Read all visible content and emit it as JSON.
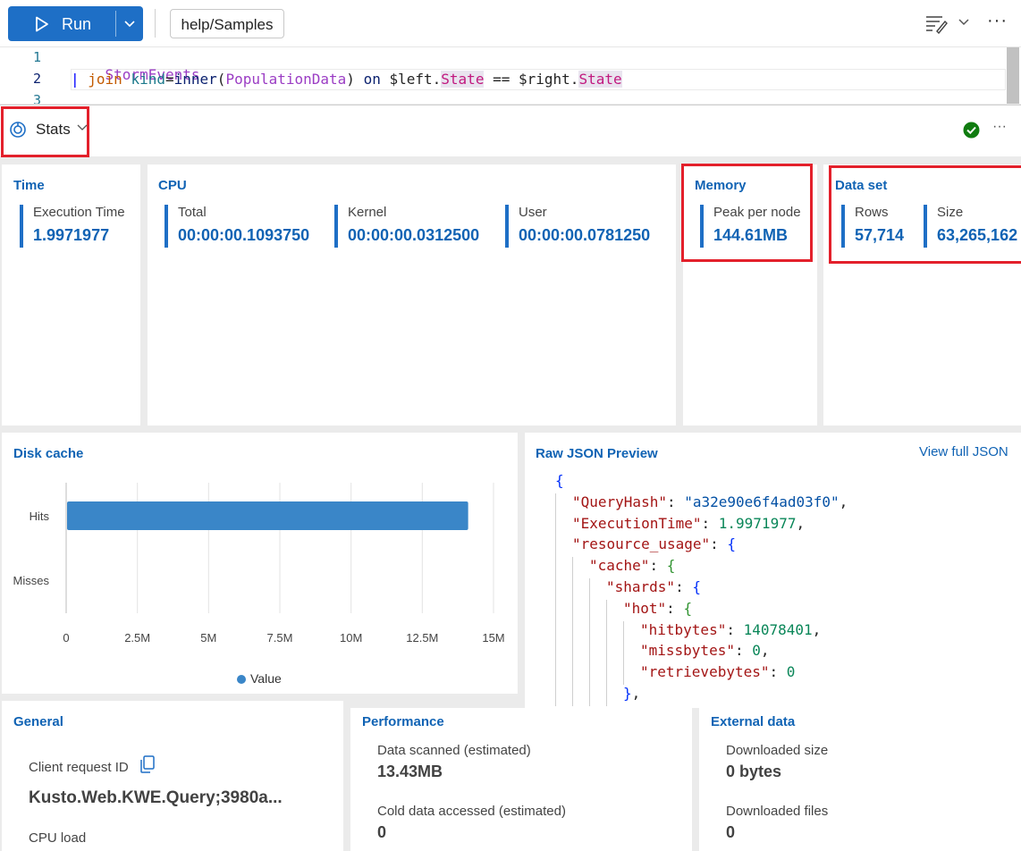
{
  "toolbar": {
    "run_label": "Run",
    "database": "help/Samples"
  },
  "editor": {
    "lines": [
      {
        "number": "1"
      },
      {
        "number": "2"
      },
      {
        "number": "3"
      }
    ],
    "line1": "StormEvents",
    "line2": {
      "pipe": "|",
      "join": "join",
      "kind": "kind",
      "eq": "=",
      "inner": "inner",
      "lparen": "(",
      "table": "PopulationData",
      "rparen": ")",
      "on": "on",
      "left": "$left.",
      "col1": "State",
      "op": "==",
      "right": "$right.",
      "col2": "State"
    }
  },
  "stats_header": {
    "label": "Stats"
  },
  "time": {
    "title": "Time",
    "metrics": [
      {
        "label": "Execution Time",
        "value": "1.9971977"
      }
    ]
  },
  "cpu": {
    "title": "CPU",
    "metrics": [
      {
        "label": "Total",
        "value": "00:00:00.1093750"
      },
      {
        "label": "Kernel",
        "value": "00:00:00.0312500"
      },
      {
        "label": "User",
        "value": "00:00:00.0781250"
      }
    ]
  },
  "memory": {
    "title": "Memory",
    "metrics": [
      {
        "label": "Peak per node",
        "value": "144.61MB"
      }
    ]
  },
  "dataset": {
    "title": "Data set",
    "metrics": [
      {
        "label": "Rows",
        "value": "57,714"
      },
      {
        "label": "Size",
        "value": "63,265,162"
      }
    ]
  },
  "disk_cache": {
    "title": "Disk cache",
    "legend": "Value"
  },
  "chart_data": {
    "type": "bar",
    "orientation": "horizontal",
    "categories": [
      "Hits",
      "Misses"
    ],
    "series": [
      {
        "name": "Value",
        "values": [
          14078401,
          0
        ]
      }
    ],
    "xlim": [
      0,
      15000000
    ],
    "xticks": [
      "0",
      "2.5M",
      "5M",
      "7.5M",
      "10M",
      "12.5M",
      "15M"
    ],
    "xtick_values": [
      0,
      2500000,
      5000000,
      7500000,
      10000000,
      12500000,
      15000000
    ],
    "grid": true,
    "legend_position": "bottom",
    "colors": [
      "#3a86c8"
    ]
  },
  "json_preview": {
    "title": "Raw JSON Preview",
    "view_full": "View full JSON",
    "lines": [
      {
        "open": "{"
      },
      {
        "key": "\"QueryHash\"",
        "sep": ": ",
        "str": "\"a32e90e6f4ad03f0\"",
        "end": ","
      },
      {
        "key": "\"ExecutionTime\"",
        "sep": ": ",
        "num": "1.9971977",
        "end": ","
      },
      {
        "key": "\"resource_usage\"",
        "sep": ": ",
        "open": "{"
      },
      {
        "key": "\"cache\"",
        "sep": ": ",
        "open": "{"
      },
      {
        "key": "\"shards\"",
        "sep": ": ",
        "open": "{"
      },
      {
        "key": "\"hot\"",
        "sep": ": ",
        "open": "{"
      },
      {
        "key": "\"hitbytes\"",
        "sep": ": ",
        "num": "14078401",
        "end": ","
      },
      {
        "key": "\"missbytes\"",
        "sep": ": ",
        "num": "0",
        "end": ","
      },
      {
        "key": "\"retrievebytes\"",
        "sep": ": ",
        "num": "0"
      },
      {
        "close": "}",
        "end": ","
      }
    ]
  },
  "general": {
    "title": "General",
    "client_request_label": "Client request ID",
    "client_request_value": "Kusto.Web.KWE.Query;3980a...",
    "cpu_load_label": "CPU load"
  },
  "performance": {
    "title": "Performance",
    "scanned_label": "Data scanned (estimated)",
    "scanned_value": "13.43MB",
    "cold_label": "Cold data accessed (estimated)",
    "cold_value": "0"
  },
  "external": {
    "title": "External data",
    "size_label": "Downloaded size",
    "size_value": "0 bytes",
    "files_label": "Downloaded files",
    "files_value": "0"
  },
  "colors": {
    "accent": "#1e6fc6",
    "title_blue": "#1063b4",
    "highlight_red": "#e3202b",
    "success_green": "#107c10"
  }
}
